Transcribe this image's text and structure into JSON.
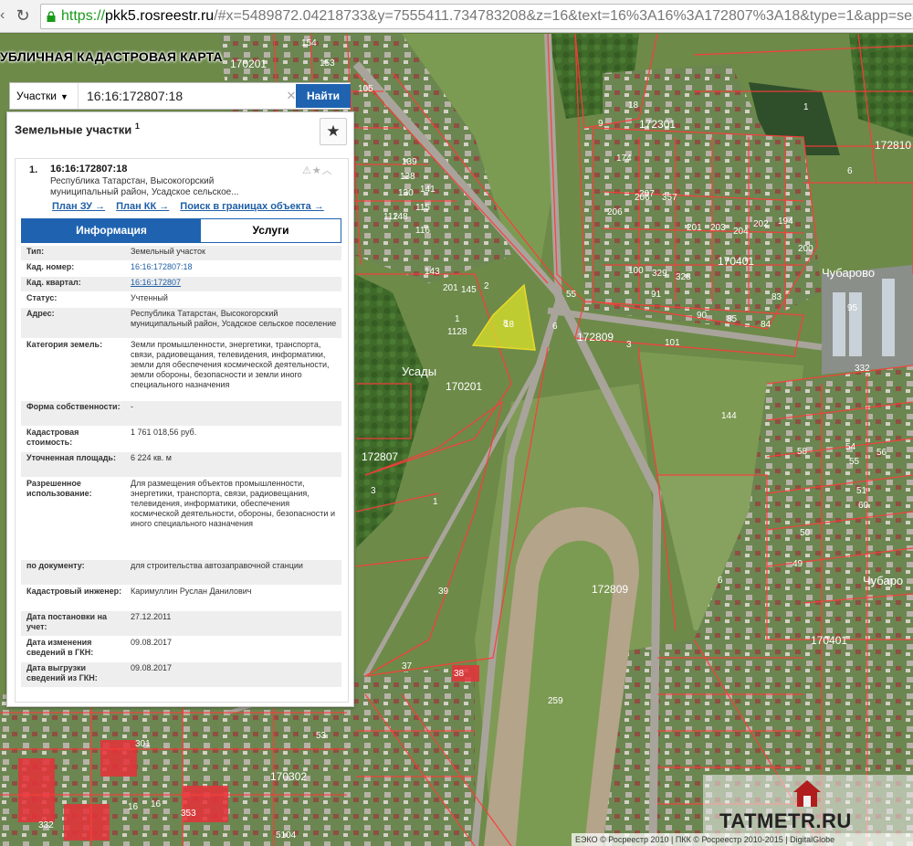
{
  "browser": {
    "url_protocol": "https://",
    "url_host": "pkk5.rosreestr.ru",
    "url_rest": "/#x=5489872.04218733&y=7555411.734783208&z=16&text=16%3A16%3A172807%3A18&type=1&app=sea"
  },
  "map": {
    "title": "УБЛИЧНАЯ КАДАСТРОВАЯ КАРТА",
    "quarter_labels": [
      "170201",
      "172301",
      "172810",
      "170401",
      "172809",
      "170201",
      "172807",
      "172809",
      "170401",
      "170302"
    ],
    "place_labels": [
      "Чубарово",
      "Усады",
      "Чубаро"
    ],
    "parcel_labels": [
      "105",
      "153",
      "154",
      "139",
      "138",
      "130",
      "112",
      "141",
      "115",
      "116",
      "148",
      "143",
      "145",
      "201",
      "206",
      "207",
      "2",
      "1",
      "1128",
      "1",
      "9",
      "6",
      "18",
      "8",
      "55",
      "6",
      "3",
      "101",
      "144",
      "332",
      "56",
      "54",
      "55",
      "58",
      "51",
      "50",
      "60",
      "49",
      "6",
      "259",
      "38",
      "37",
      "53",
      "301",
      "353",
      "332",
      "5104",
      "16",
      "16",
      "3",
      "39",
      "1",
      "174",
      "206",
      "357",
      "201",
      "203",
      "204",
      "194",
      "202",
      "200",
      "100",
      "329",
      "328",
      "91",
      "90",
      "85",
      "84",
      "83",
      "95",
      "1"
    ],
    "highlight_label": "18"
  },
  "search": {
    "type_label": "Участки",
    "query": "16:16:172807:18",
    "button_label": "Найти"
  },
  "panel": {
    "heading": "Земельные участки",
    "heading_count": "1",
    "item_number": "1.",
    "item_title": "16:16:172807:18",
    "item_address": "Республика Татарстан, Высокогорский муниципальный район, Усадское сельское...",
    "links": [
      "План ЗУ →",
      "План КК →",
      "Поиск в границах объекта →"
    ],
    "tabs": [
      "Информация",
      "Услуги"
    ],
    "rows": [
      {
        "key": "Тип:",
        "value": "Земельный участок"
      },
      {
        "key": "Кад. номер:",
        "value": "16:16:172807:18"
      },
      {
        "key": "Кад. квартал:",
        "value": "16:16:172807"
      },
      {
        "key": "Статус:",
        "value": "Учтенный"
      },
      {
        "key": "Адрес:",
        "value": "Республика Татарстан, Высокогорский муниципальный район, Усадское сельское поселение"
      },
      {
        "key": "Категория земель:",
        "value": "Земли промышленности, энергетики, транспорта, связи, радиовещания, телевидения, информатики, земли для обеспечения космической деятельности, земли обороны, безопасности и земли иного специального назначения"
      },
      {
        "key": "Форма собственности:",
        "value": "-"
      },
      {
        "key": "Кадастровая стоимость:",
        "value": "1 761 018,56 руб."
      },
      {
        "key": "Уточненная площадь:",
        "value": "6 224 кв. м"
      },
      {
        "key": "Разрешенное использование:",
        "value": "Для размещения объектов промышленности, энергетики, транспорта, связи, радиовещания, телевидения, информатики, обеспечения космической деятельности, обороны, безопасности и иного специального назначения"
      },
      {
        "key": "по документу:",
        "value": "для строительства автозаправочной станции"
      },
      {
        "key": "Кадастровый инженер:",
        "value": "Каримуллин Руслан Данилович"
      },
      {
        "key": "Дата постановки на учет:",
        "value": "27.12.2011"
      },
      {
        "key": "Дата изменения сведений в ГКН:",
        "value": "09.08.2017"
      },
      {
        "key": "Дата выгрузки сведений из ГКН:",
        "value": "09.08.2017"
      }
    ]
  },
  "footer": {
    "attribution": "ЕЭКО © Росреестр 2010 | ПКК © Росреестр 2010-2015 | DigitalGlobe",
    "watermark": "TATMETR.RU"
  },
  "colors": {
    "accent": "#1f63b0",
    "parcel_border": "#e8303a",
    "highlight_fill": "#d9e22a"
  }
}
